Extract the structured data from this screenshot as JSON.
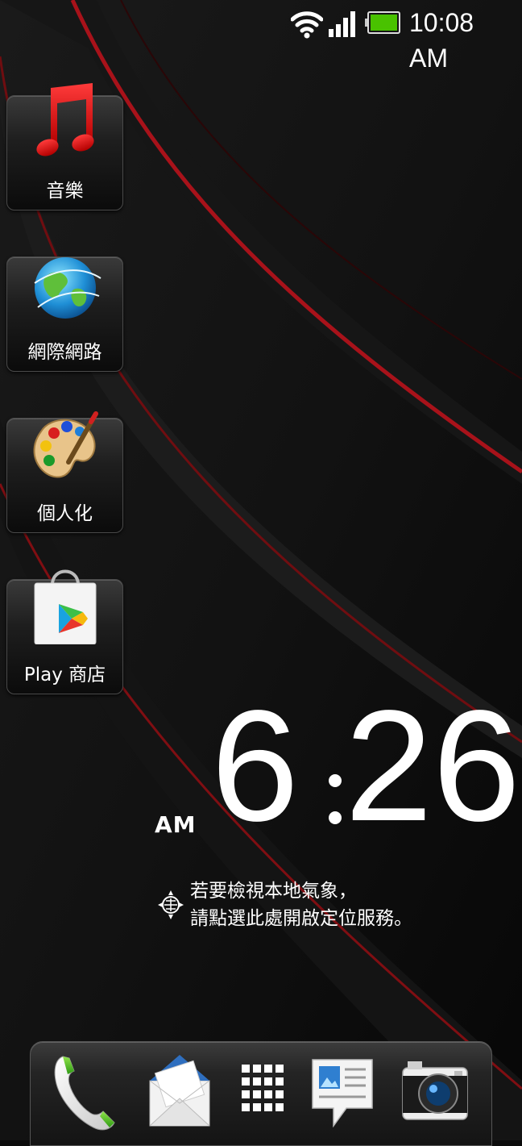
{
  "status_bar": {
    "time": "10:08 AM",
    "icons": [
      "wifi-icon",
      "signal-icon",
      "battery-icon"
    ]
  },
  "apps": [
    {
      "label": "音樂",
      "icon": "music-note-icon"
    },
    {
      "label": "網際網路",
      "icon": "globe-icon"
    },
    {
      "label": "個人化",
      "icon": "palette-icon"
    },
    {
      "label": "Play 商店",
      "icon": "play-store-bag-icon"
    }
  ],
  "clock": {
    "ampm": "AM",
    "hour": "6",
    "minutes": "26"
  },
  "weather": {
    "icon": "gps-icon",
    "line1": "若要檢視本地氣象，",
    "line2": "請點選此處開啟定位服務。"
  },
  "dock": {
    "items": [
      "phone-icon",
      "mail-icon",
      "all-apps-icon",
      "messages-icon",
      "camera-icon"
    ]
  },
  "colors": {
    "accent_red": "#c4141a",
    "wallpaper": "#0b0b0b"
  }
}
